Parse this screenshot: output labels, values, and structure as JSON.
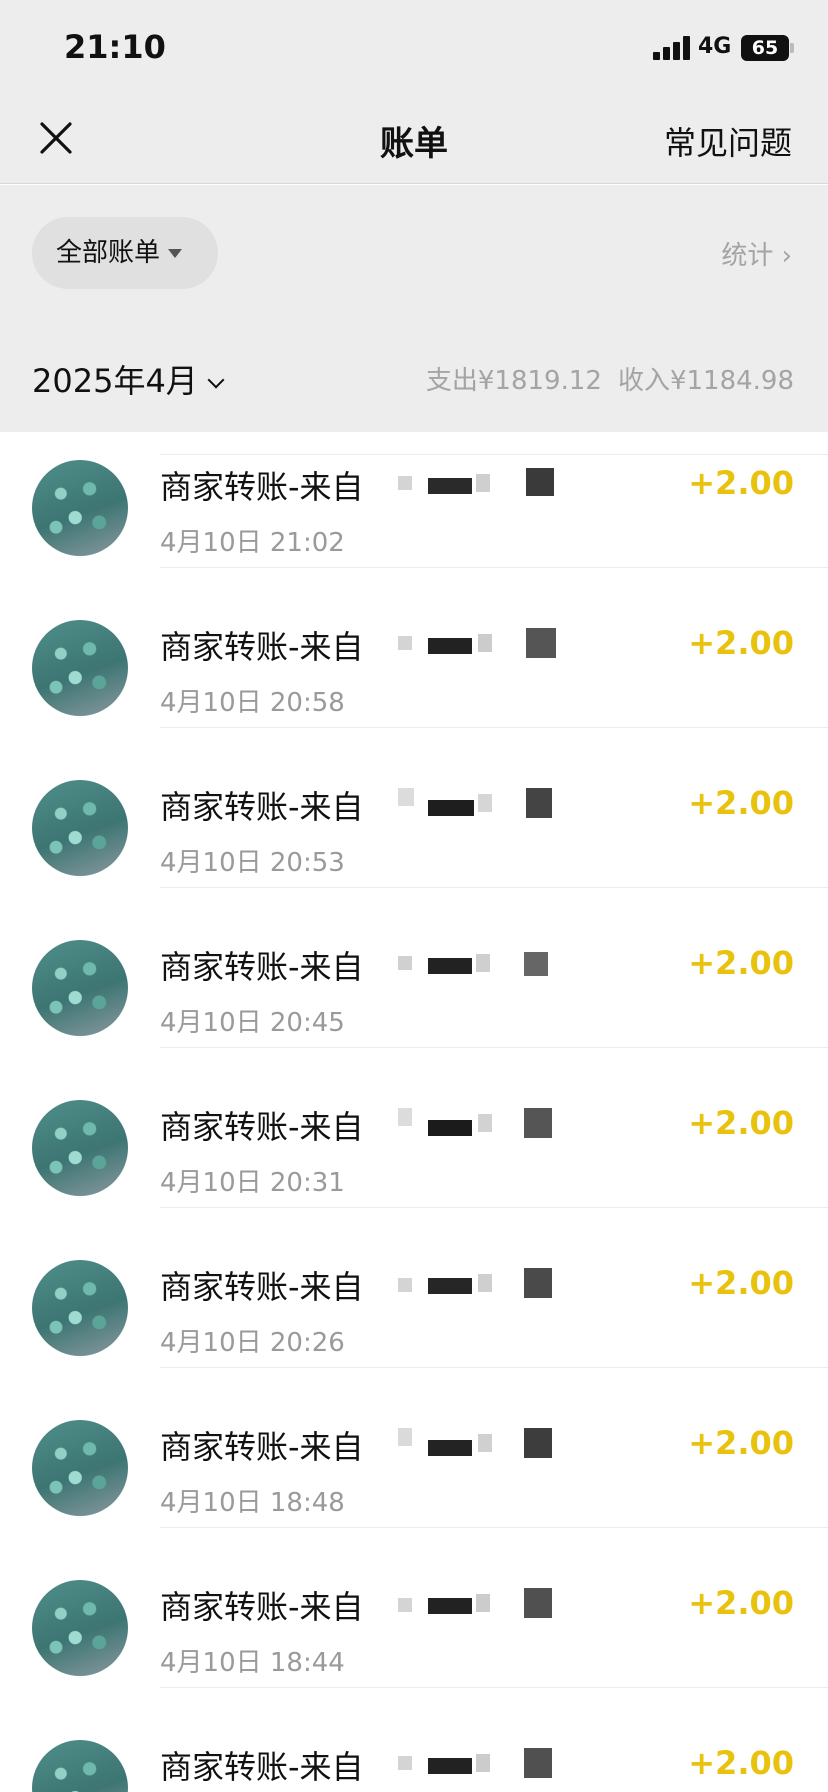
{
  "status_bar": {
    "time": "21:10",
    "network": "4G",
    "battery": "65"
  },
  "nav": {
    "title": "账单",
    "faq_label": "常见问题"
  },
  "filter": {
    "all_bills_label": "全部账单",
    "stats_label": "统计 ›"
  },
  "month_header": {
    "month": "2025年4月",
    "expense": "支出¥1819.12",
    "income": "收入¥1184.98"
  },
  "transactions": [
    {
      "title": "商家转账-来自",
      "time": "4月10日 21:02",
      "amount": "+2.00"
    },
    {
      "title": "商家转账-来自",
      "time": "4月10日 20:58",
      "amount": "+2.00"
    },
    {
      "title": "商家转账-来自",
      "time": "4月10日 20:53",
      "amount": "+2.00"
    },
    {
      "title": "商家转账-来自",
      "time": "4月10日 20:45",
      "amount": "+2.00"
    },
    {
      "title": "商家转账-来自",
      "time": "4月10日 20:31",
      "amount": "+2.00"
    },
    {
      "title": "商家转账-来自",
      "time": "4月10日 20:26",
      "amount": "+2.00"
    },
    {
      "title": "商家转账-来自",
      "time": "4月10日 18:48",
      "amount": "+2.00"
    },
    {
      "title": "商家转账-来自",
      "time": "4月10日 18:44",
      "amount": "+2.00"
    },
    {
      "title": "商家转账-来自",
      "time": "",
      "amount": "+2.00"
    }
  ],
  "colors": {
    "amount_income": "#e8c20e",
    "page_bg": "#ededed"
  },
  "icons": {
    "close": "close-icon",
    "avatar": "avatar-image"
  }
}
